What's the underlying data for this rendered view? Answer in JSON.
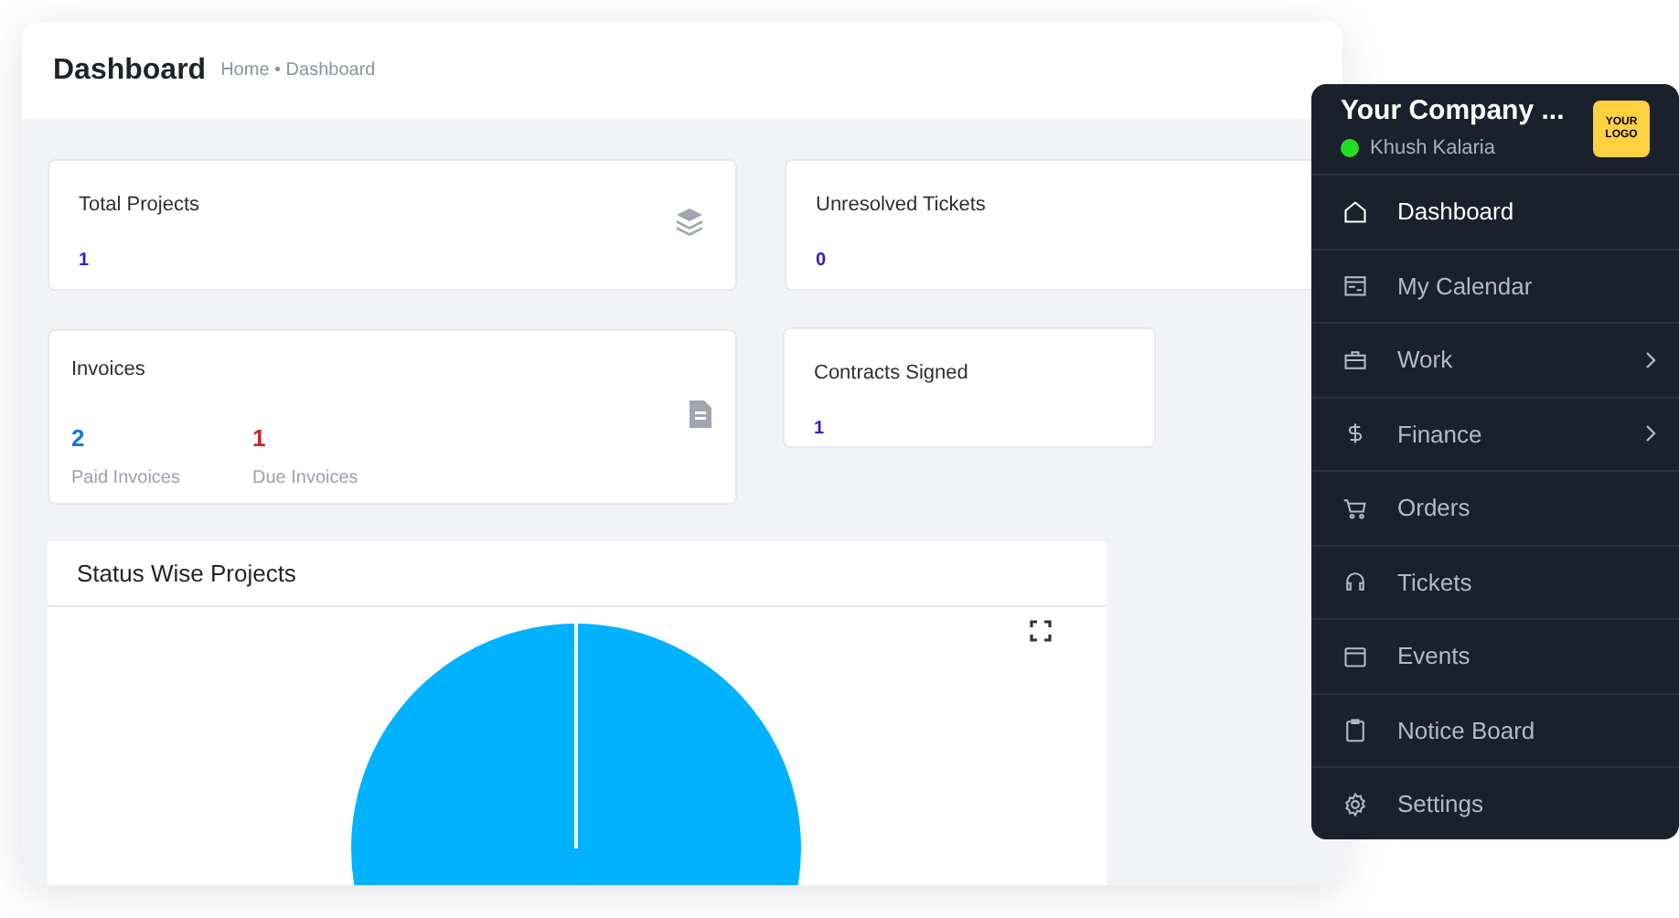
{
  "header": {
    "title": "Dashboard",
    "breadcrumb": "Home • Dashboard"
  },
  "cards": [
    {
      "kind": "single",
      "title": "Total Projects",
      "value": "1",
      "icon": true
    },
    {
      "kind": "single",
      "title": "Unresolved Tickets",
      "value": "0",
      "icon": false
    },
    {
      "kind": "invoices",
      "title": "Invoices",
      "stats": [
        {
          "value": "2",
          "label": "Paid Invoices",
          "color": "#1a73e8"
        },
        {
          "value": "1",
          "label": "Due Invoices",
          "color": "#c62828"
        }
      ]
    },
    {
      "kind": "single",
      "title": "Contracts Signed",
      "value": "1",
      "icon": false
    }
  ],
  "chart_panel": {
    "title": "Status Wise Projects"
  },
  "sidebar": {
    "company": "Your Company ...",
    "user": "Khush Kalaria",
    "online": true,
    "logo": [
      "YOUR",
      "LOGO"
    ],
    "items": [
      {
        "label": "Dashboard",
        "selected": true,
        "has_submenu": false
      },
      {
        "label": "My Calendar",
        "selected": false,
        "has_submenu": false
      },
      {
        "label": "Work",
        "selected": false,
        "has_submenu": true
      },
      {
        "label": "Finance",
        "selected": false,
        "has_submenu": true
      },
      {
        "label": "Orders",
        "selected": false,
        "has_submenu": false
      },
      {
        "label": "Tickets",
        "selected": false,
        "has_submenu": false
      },
      {
        "label": "Events",
        "selected": false,
        "has_submenu": false
      },
      {
        "label": "Notice Board",
        "selected": false,
        "has_submenu": false
      },
      {
        "label": "Settings",
        "selected": false,
        "has_submenu": false
      }
    ]
  }
}
